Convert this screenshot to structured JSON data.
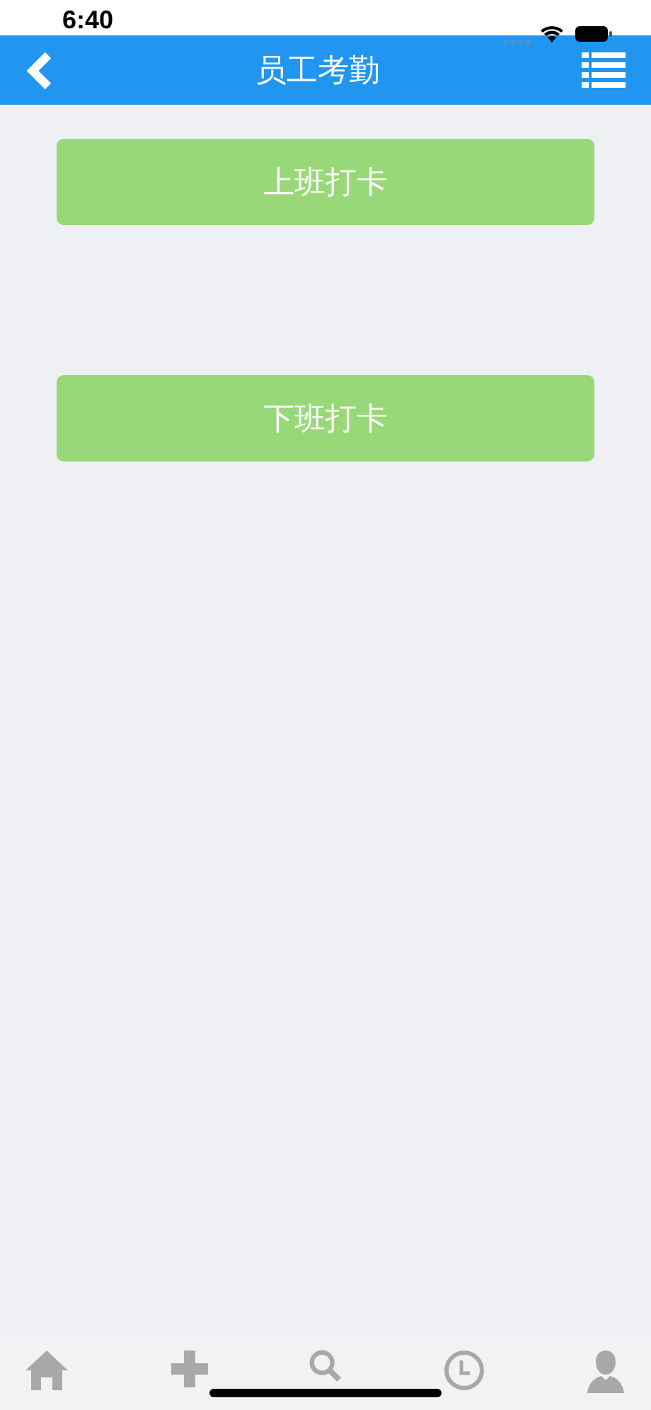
{
  "status_bar": {
    "time": "6:40"
  },
  "nav_bar": {
    "title": "员工考勤"
  },
  "buttons": [
    "上班打卡",
    "下班打卡"
  ]
}
